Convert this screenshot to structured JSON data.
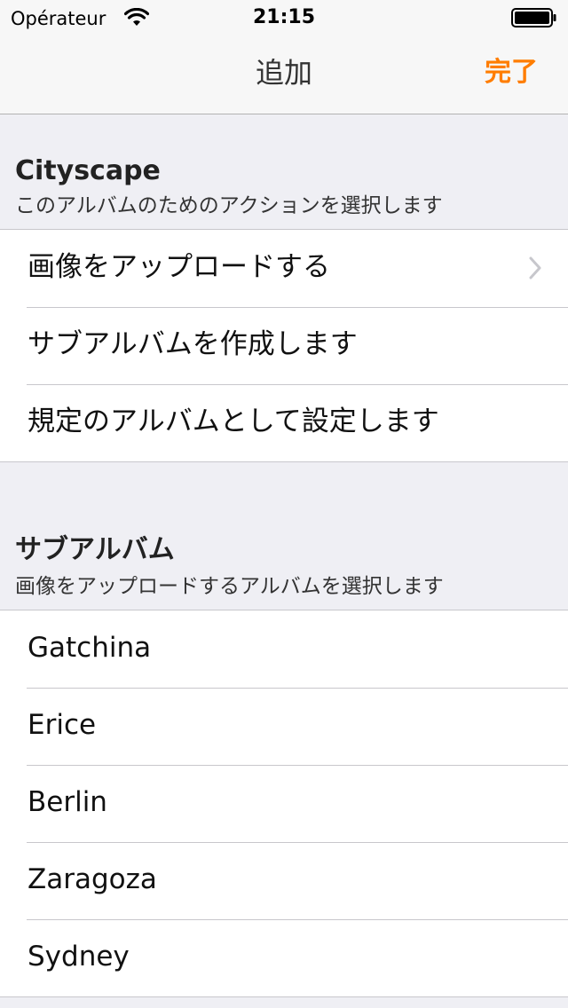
{
  "status_bar": {
    "carrier": "Opérateur",
    "time": "21:15",
    "wifi_icon": "wifi-icon",
    "battery_icon": "battery-icon"
  },
  "nav": {
    "title": "追加",
    "done_label": "完了",
    "accent_color": "#ff7d00"
  },
  "actions_section": {
    "title": "Cityscape",
    "subtitle": "このアルバムのためのアクションを選択します",
    "items": [
      {
        "label": "画像をアップロードする",
        "icon": "chevron-right-icon"
      },
      {
        "label": "サブアルバムを作成します"
      },
      {
        "label": "規定のアルバムとして設定します"
      }
    ]
  },
  "subalbums_section": {
    "title": "サブアルバム",
    "subtitle": "画像をアップロードするアルバムを選択します",
    "items": [
      {
        "label": "Gatchina"
      },
      {
        "label": "Erice"
      },
      {
        "label": "Berlin"
      },
      {
        "label": "Zaragoza"
      },
      {
        "label": "Sydney"
      }
    ]
  }
}
